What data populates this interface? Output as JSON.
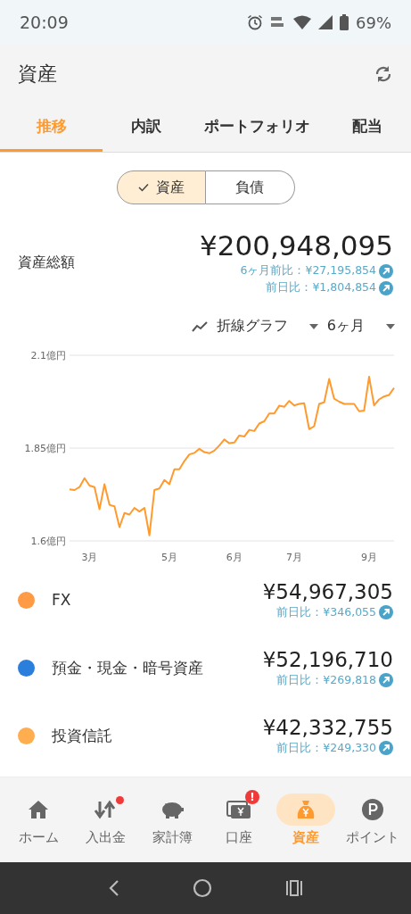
{
  "status_bar": {
    "time": "20:09",
    "battery": "69%"
  },
  "app_bar": {
    "title": "資産"
  },
  "tabs": [
    {
      "label": "推移",
      "selected": true
    },
    {
      "label": "内訳",
      "selected": false
    },
    {
      "label": "ポートフォリオ",
      "selected": false
    },
    {
      "label": "配当",
      "selected": false
    }
  ],
  "segments": [
    {
      "label": "資産",
      "selected": true
    },
    {
      "label": "負債",
      "selected": false
    }
  ],
  "total": {
    "label": "資産総額",
    "amount": "¥200,948,095",
    "changes": [
      "6ヶ月前比：¥27,195,854",
      "前日比：¥1,804,854"
    ]
  },
  "chart_controls": {
    "chart_type": "折線グラフ",
    "period": "6ヶ月"
  },
  "chart_data": {
    "type": "line",
    "ylim": [
      1.6,
      2.1
    ],
    "yticks": [
      {
        "value": 1.6,
        "label": "1.6億円"
      },
      {
        "value": 1.85,
        "label": "1.85億円"
      },
      {
        "value": 2.1,
        "label": "2.1億円"
      }
    ],
    "categories": [
      null,
      null,
      null,
      null,
      "3月",
      null,
      null,
      null,
      null,
      null,
      null,
      null,
      null,
      null,
      null,
      null,
      null,
      null,
      null,
      null,
      "5月",
      null,
      null,
      null,
      null,
      null,
      null,
      null,
      null,
      null,
      null,
      null,
      null,
      "6月",
      null,
      null,
      null,
      null,
      null,
      null,
      null,
      null,
      null,
      null,
      null,
      "7月",
      null,
      null,
      null,
      null,
      null,
      null,
      null,
      null,
      null,
      null,
      null,
      null,
      null,
      null,
      "9月",
      null,
      null,
      null,
      null,
      null
    ],
    "series": [
      {
        "color": "#ff9a2e",
        "values": [
          1.739,
          1.737,
          1.745,
          1.769,
          1.749,
          1.745,
          1.685,
          1.753,
          1.697,
          1.693,
          1.637,
          1.675,
          1.671,
          1.689,
          1.679,
          1.689,
          1.615,
          1.737,
          1.741,
          1.764,
          1.753,
          1.793,
          1.793,
          1.815,
          1.833,
          1.837,
          1.848,
          1.839,
          1.836,
          1.843,
          1.857,
          1.873,
          1.863,
          1.865,
          1.884,
          1.881,
          1.899,
          1.896,
          1.916,
          1.922,
          1.943,
          1.943,
          1.964,
          1.961,
          1.977,
          1.965,
          1.969,
          1.971,
          1.901,
          1.909,
          1.969,
          1.973,
          2.036,
          1.983,
          1.975,
          1.969,
          1.969,
          1.969,
          1.949,
          1.951,
          2.042,
          1.965,
          1.981,
          1.989,
          1.993,
          2.012
        ]
      }
    ]
  },
  "assets": [
    {
      "name": "FX",
      "color": "#ff9a45",
      "amount": "¥54,967,305",
      "change": "前日比：¥346,055"
    },
    {
      "name": "預金・現金・暗号資産",
      "color": "#2a7fdc",
      "amount": "¥52,196,710",
      "change": "前日比：¥269,818"
    },
    {
      "name": "投資信託",
      "color": "#ffae4f",
      "amount": "¥42,332,755",
      "change": "前日比：¥249,330"
    }
  ],
  "bottom_nav": [
    {
      "label": "ホーム",
      "selected": false
    },
    {
      "label": "入出金",
      "selected": false,
      "dot": true
    },
    {
      "label": "家計簿",
      "selected": false
    },
    {
      "label": "口座",
      "selected": false,
      "badge": "!"
    },
    {
      "label": "資産",
      "selected": true
    },
    {
      "label": "ポイント",
      "selected": false
    }
  ]
}
